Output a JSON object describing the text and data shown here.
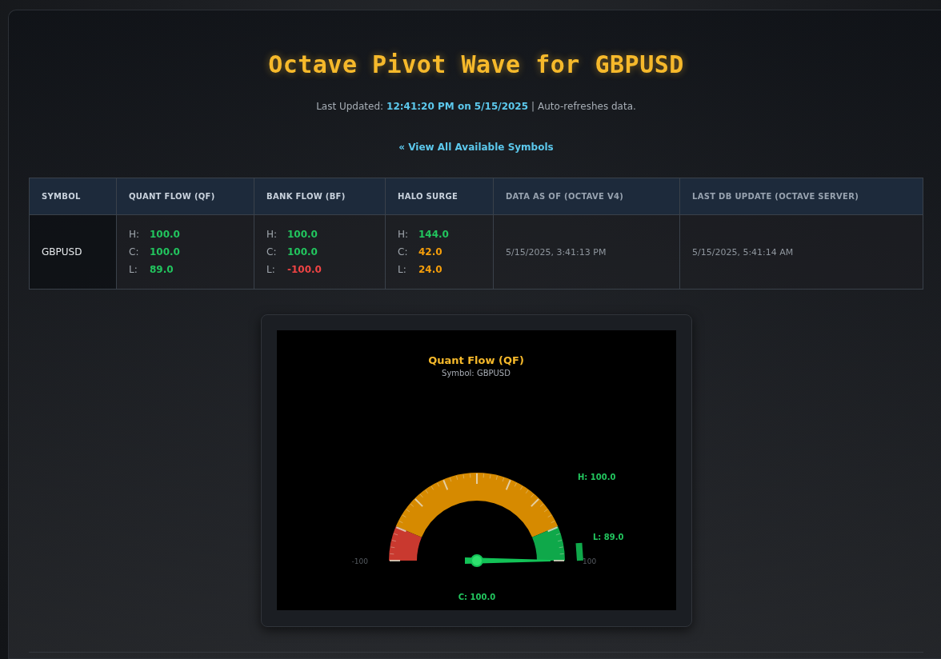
{
  "header": {
    "title": "Octave Pivot Wave for GBPUSD",
    "updated_label": "Last Updated:",
    "updated_value": "12:41:20 PM on 5/15/2025",
    "refresh_note": "| Auto-refreshes data.",
    "symbols_link": "« View All Available Symbols"
  },
  "table": {
    "columns": [
      "SYMBOL",
      "QUANT FLOW (QF)",
      "BANK FLOW (BF)",
      "HALO SURGE",
      "DATA AS OF (OCTAVE V4)",
      "LAST DB UPDATE (OCTAVE SERVER)"
    ],
    "rows": [
      {
        "cells": [
          {
            "kind": "symbol",
            "text": "GBPUSD"
          },
          {
            "kind": "levels",
            "lines": [
              {
                "label": "H:",
                "value": "100.0",
                "color": "#22c55e"
              },
              {
                "label": "C:",
                "value": "100.0",
                "color": "#22c55e"
              },
              {
                "label": "L:",
                "value": "89.0",
                "color": "#22c55e"
              }
            ]
          },
          {
            "kind": "levels",
            "lines": [
              {
                "label": "H:",
                "value": "100.0",
                "color": "#22c55e"
              },
              {
                "label": "C:",
                "value": "100.0",
                "color": "#22c55e"
              },
              {
                "label": "L:",
                "value": "-100.0",
                "color": "#ef4444"
              }
            ]
          },
          {
            "kind": "levels",
            "lines": [
              {
                "label": "H:",
                "value": "144.0",
                "color": "#22c55e"
              },
              {
                "label": "C:",
                "value": "42.0",
                "color": "#f59e0b"
              },
              {
                "label": "L:",
                "value": "24.0",
                "color": "#f59e0b"
              }
            ]
          },
          {
            "kind": "timestamp",
            "text": "5/15/2025, 3:41:13 PM"
          },
          {
            "kind": "timestamp",
            "text": "5/15/2025, 5:41:14 AM"
          }
        ]
      }
    ]
  },
  "gauge": {
    "title": "Quant Flow (QF)",
    "subtitle": "Symbol: GBPUSD",
    "min_label": "-100",
    "max_label": "100",
    "high_label": "H: 100.0",
    "low_label": "L: 89.0",
    "close_label": "C: 100.0"
  }
}
